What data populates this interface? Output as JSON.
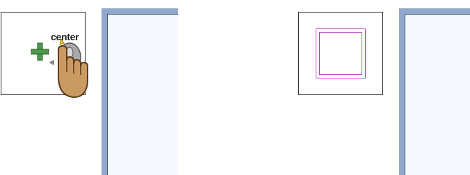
{
  "left_preview": {
    "cursor_tooltip": "center",
    "cursor_icon": "hand-pointer-plus-icon"
  },
  "right_preview": {
    "shape_icon": "double-square-icon",
    "shape_color": "#c040c0"
  },
  "panels": {
    "border_color": "#8fa8cc",
    "fill_color": "#f4f8ff"
  }
}
